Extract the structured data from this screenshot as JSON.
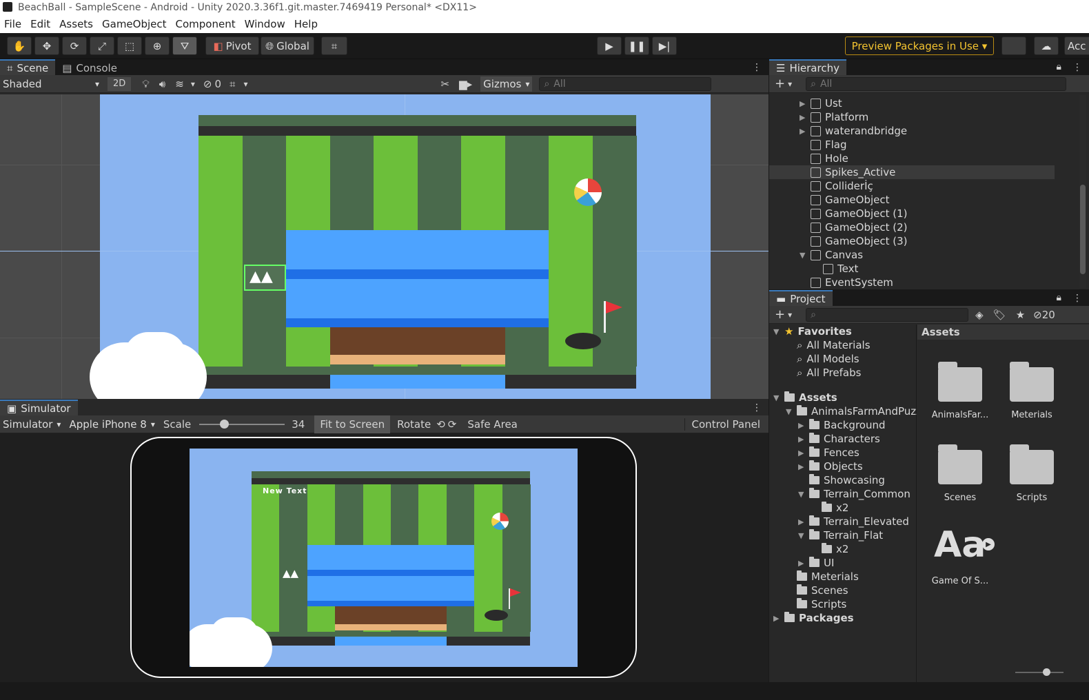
{
  "window": {
    "title": "BeachBall - SampleScene - Android - Unity 2020.3.36f1.git.master.7469419 Personal* <DX11>"
  },
  "menu": [
    "File",
    "Edit",
    "Assets",
    "GameObject",
    "Component",
    "Window",
    "Help"
  ],
  "toolbar": {
    "pivot": "Pivot",
    "global": "Global",
    "preview_packages": "Preview Packages in Use",
    "account": "Acc"
  },
  "scene_tabs": {
    "scene": "Scene",
    "console": "Console"
  },
  "scene_bar": {
    "shading": "Shaded",
    "mode_2d": "2D",
    "hidden_count": "0",
    "gizmos": "Gizmos",
    "search_placeholder": "All"
  },
  "hierarchy": {
    "tab": "Hierarchy",
    "search_placeholder": "All",
    "items": [
      {
        "label": "Ust",
        "expandable": true,
        "indent": 1
      },
      {
        "label": "Platform",
        "expandable": true,
        "indent": 1
      },
      {
        "label": "waterandbridge",
        "expandable": true,
        "indent": 1
      },
      {
        "label": "Flag",
        "expandable": false,
        "indent": 1
      },
      {
        "label": "Hole",
        "expandable": false,
        "indent": 1
      },
      {
        "label": "Spikes_Active",
        "expandable": false,
        "indent": 1,
        "selected": true
      },
      {
        "label": "Colliderİç",
        "expandable": false,
        "indent": 1
      },
      {
        "label": "GameObject",
        "expandable": false,
        "indent": 1
      },
      {
        "label": "GameObject (1)",
        "expandable": false,
        "indent": 1
      },
      {
        "label": "GameObject (2)",
        "expandable": false,
        "indent": 1
      },
      {
        "label": "GameObject (3)",
        "expandable": false,
        "indent": 1
      },
      {
        "label": "Canvas",
        "expandable": true,
        "expanded": true,
        "indent": 1
      },
      {
        "label": "Text",
        "expandable": false,
        "indent": 2
      },
      {
        "label": "EventSystem",
        "expandable": false,
        "indent": 1
      }
    ]
  },
  "project": {
    "tab": "Project",
    "hidden_count": "20",
    "favorites": {
      "label": "Favorites",
      "items": [
        "All Materials",
        "All Models",
        "All Prefabs"
      ]
    },
    "tree": [
      {
        "label": "Assets",
        "indent": 0,
        "bold": true
      },
      {
        "label": "AnimalsFarmAndPuzz",
        "indent": 1
      },
      {
        "label": "Background",
        "indent": 2
      },
      {
        "label": "Characters",
        "indent": 2
      },
      {
        "label": "Fences",
        "indent": 2
      },
      {
        "label": "Objects",
        "indent": 2
      },
      {
        "label": "Showcasing",
        "indent": 2
      },
      {
        "label": "Terrain_Common",
        "indent": 2
      },
      {
        "label": "x2",
        "indent": 3
      },
      {
        "label": "Terrain_Elevated",
        "indent": 2
      },
      {
        "label": "Terrain_Flat",
        "indent": 2
      },
      {
        "label": "x2",
        "indent": 3
      },
      {
        "label": "UI",
        "indent": 2
      },
      {
        "label": "Meterials",
        "indent": 1
      },
      {
        "label": "Scenes",
        "indent": 1
      },
      {
        "label": "Scripts",
        "indent": 1
      },
      {
        "label": "Packages",
        "indent": 0,
        "bold": true
      }
    ],
    "assets_header": "Assets",
    "assets": [
      "AnimalsFar...",
      "Meterials",
      "Scenes",
      "Scripts",
      "Game Of S..."
    ]
  },
  "simulator": {
    "tab": "Simulator",
    "mode": "Simulator",
    "device": "Apple iPhone 8",
    "scale_label": "Scale",
    "scale_value": "34",
    "fit": "Fit to Screen",
    "rotate": "Rotate",
    "safe_area": "Safe Area",
    "control_panel": "Control Panel",
    "game_text": "New Text"
  },
  "colors": {
    "accent": "#3a79bb",
    "sky": "#8ab4f0",
    "grass_light": "#6cbf3a",
    "grass_dark": "#4a6a4c",
    "water": "#4da3ff",
    "water_dark": "#1f6fe6",
    "wood": "#6b4127",
    "preview": "#f4c430"
  }
}
